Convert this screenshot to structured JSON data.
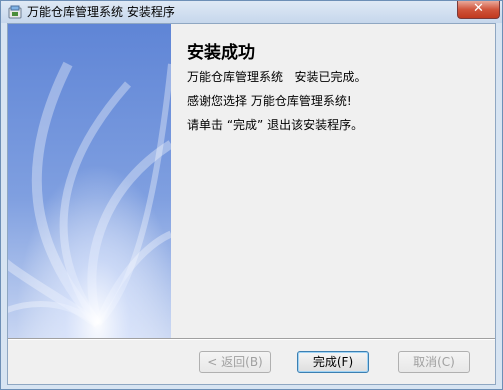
{
  "window": {
    "title": "万能仓库管理系统 安装程序",
    "close_label": "✕"
  },
  "content": {
    "heading": "安装成功",
    "line1": "万能仓库管理系统   安装已完成。",
    "line2": "感谢您选择 万能仓库管理系统!",
    "line3": "请单击 “完成” 退出该安装程序。"
  },
  "buttons": {
    "back": "< 返回(B)",
    "finish": "完成(F)",
    "cancel": "取消(C)"
  },
  "colors": {
    "banner_top": "#5f85d6",
    "banner_bottom": "#c7d5f2",
    "title_bar": "#c6d7ec",
    "close_red": "#c0391f"
  }
}
